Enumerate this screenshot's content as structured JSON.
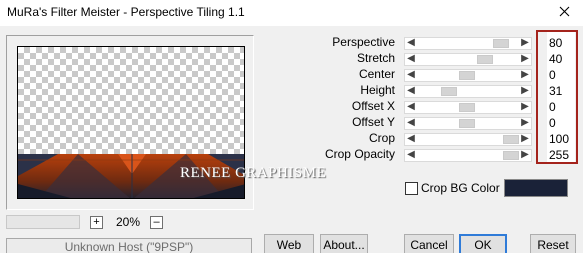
{
  "window": {
    "title": "MuRa's Filter Meister - Perspective Tiling 1.1"
  },
  "preview": {
    "watermark": "RENEE GRAPHISME"
  },
  "zoom": {
    "plus": "+",
    "value": "20%",
    "minus": "–"
  },
  "status": {
    "host_text": "Unknown Host (\"9PSP\")"
  },
  "params": [
    {
      "label": "Perspective",
      "value": "80"
    },
    {
      "label": "Stretch",
      "value": "40"
    },
    {
      "label": "Center",
      "value": "0"
    },
    {
      "label": "Height",
      "value": "31"
    },
    {
      "label": "Offset X",
      "value": "0"
    },
    {
      "label": "Offset Y",
      "value": "0"
    },
    {
      "label": "Crop",
      "value": "100"
    },
    {
      "label": "Crop Opacity",
      "value": "255"
    }
  ],
  "crop_bg": {
    "label": "Crop BG Color",
    "checked": false,
    "color": "#1a2238"
  },
  "buttons": {
    "web": "Web",
    "about": "About...",
    "cancel": "Cancel",
    "ok": "OK",
    "reset": "Reset"
  },
  "icons": {
    "close": "close-icon",
    "arrow_left": "arrow-left-icon",
    "arrow_right": "arrow-right-icon"
  }
}
